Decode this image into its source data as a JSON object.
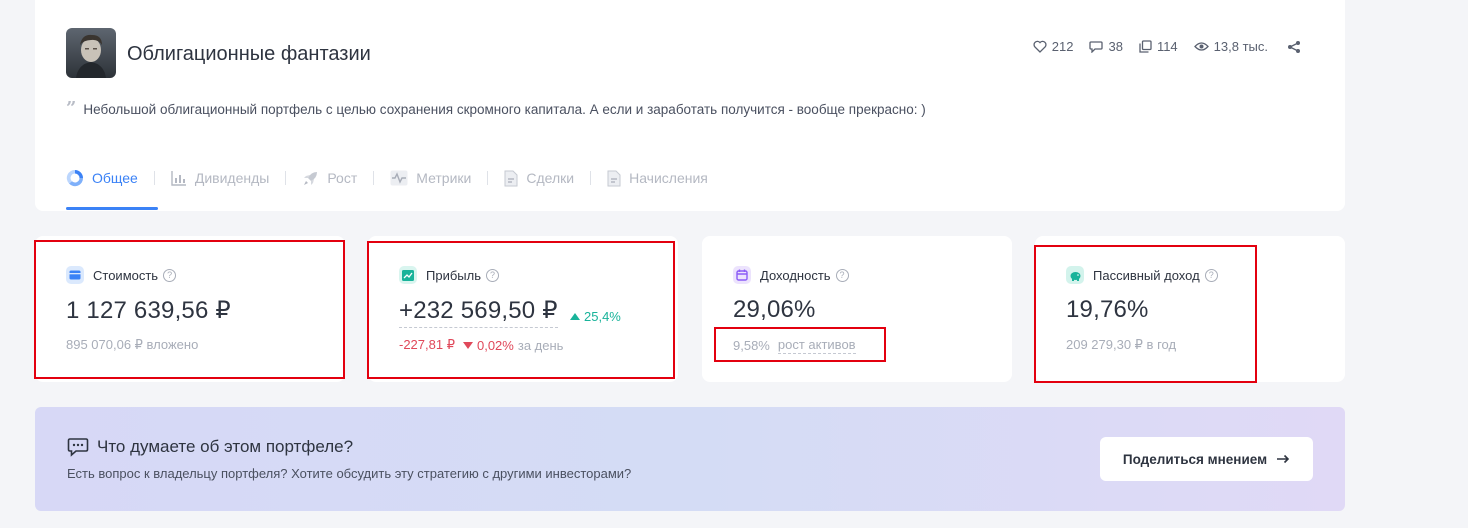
{
  "portfolio": {
    "title": "Облигационные фантазии",
    "description": "Небольшой облигационный портфель с целью сохранения скромного капитала. А если и заработать получится - вообще прекрасно: )"
  },
  "stats": {
    "likes": "212",
    "comments": "38",
    "copies": "114",
    "views": "13,8 тыс."
  },
  "tabs": [
    {
      "label": "Общее",
      "icon": "pie-chart-icon",
      "active": true
    },
    {
      "label": "Дивиденды",
      "icon": "bar-chart-icon",
      "active": false
    },
    {
      "label": "Рост",
      "icon": "rocket-icon",
      "active": false
    },
    {
      "label": "Метрики",
      "icon": "pulse-icon",
      "active": false
    },
    {
      "label": "Сделки",
      "icon": "document-icon",
      "active": false
    },
    {
      "label": "Начисления",
      "icon": "document-icon",
      "active": false
    }
  ],
  "metrics": {
    "value": {
      "label": "Стоимость",
      "amount": "1 127 639,56 ₽",
      "sub": "895 070,06 ₽ вложено"
    },
    "profit": {
      "label": "Прибыль",
      "amount": "+232 569,50 ₽",
      "growth": "25,4%",
      "day_change": "-227,81 ₽",
      "day_pct": "0,02%",
      "day_suffix": "за день"
    },
    "yield": {
      "label": "Доходность",
      "amount": "29,06%",
      "sub_value": "9,58%",
      "sub_label": "рост активов"
    },
    "passive": {
      "label": "Пассивный доход",
      "amount": "19,76%",
      "sub": "209 279,30 ₽ в год"
    }
  },
  "banner": {
    "title": "Что думаете об этом портфеле?",
    "text": "Есть вопрос к владельцу портфеля? Хотите обсудить эту стратегию с другими инвесторами?",
    "button": "Поделиться мнением",
    "button_icon": "arrow-right-icon"
  },
  "colors": {
    "accent": "#3b82f6",
    "positive": "#19b39a",
    "negative": "#e0485a",
    "highlight": "#e3000f"
  }
}
